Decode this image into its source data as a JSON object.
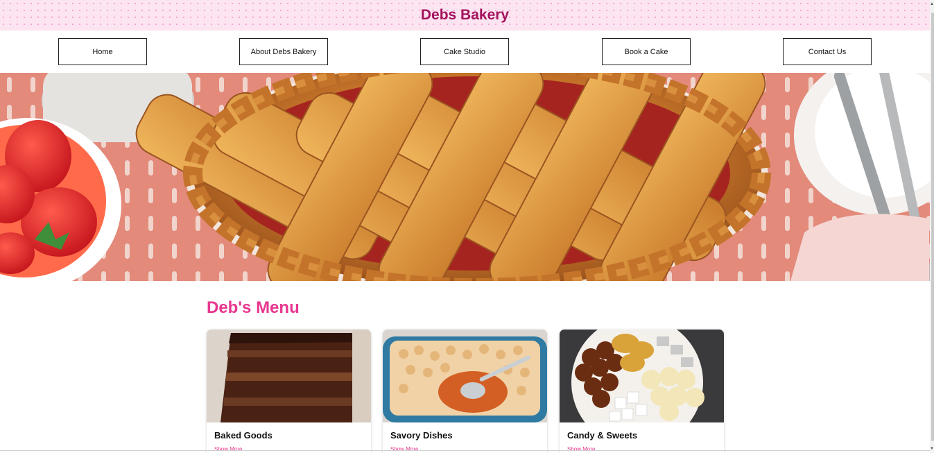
{
  "header": {
    "title": "Debs Bakery"
  },
  "nav": {
    "items": [
      {
        "label": "Home"
      },
      {
        "label": "About Debs Bakery"
      },
      {
        "label": "Cake Studio"
      },
      {
        "label": "Book a Cake"
      },
      {
        "label": "Contact Us"
      }
    ]
  },
  "hero": {
    "image": "lattice-cherry-pie-photo"
  },
  "menu": {
    "title": "Deb's Menu",
    "cards": [
      {
        "title": "Baked Goods",
        "link": "Show More",
        "image": "chocolate-layer-cake-photo"
      },
      {
        "title": "Savory Dishes",
        "link": "Show More",
        "image": "sweet-potato-casserole-photo"
      },
      {
        "title": "Candy & Sweets",
        "link": "Show More",
        "image": "indian-sweets-platter-photo"
      }
    ]
  },
  "colors": {
    "brand_title": "#a3135d",
    "accent_pink": "#e8368f",
    "banner_bg": "#fde4f1"
  }
}
